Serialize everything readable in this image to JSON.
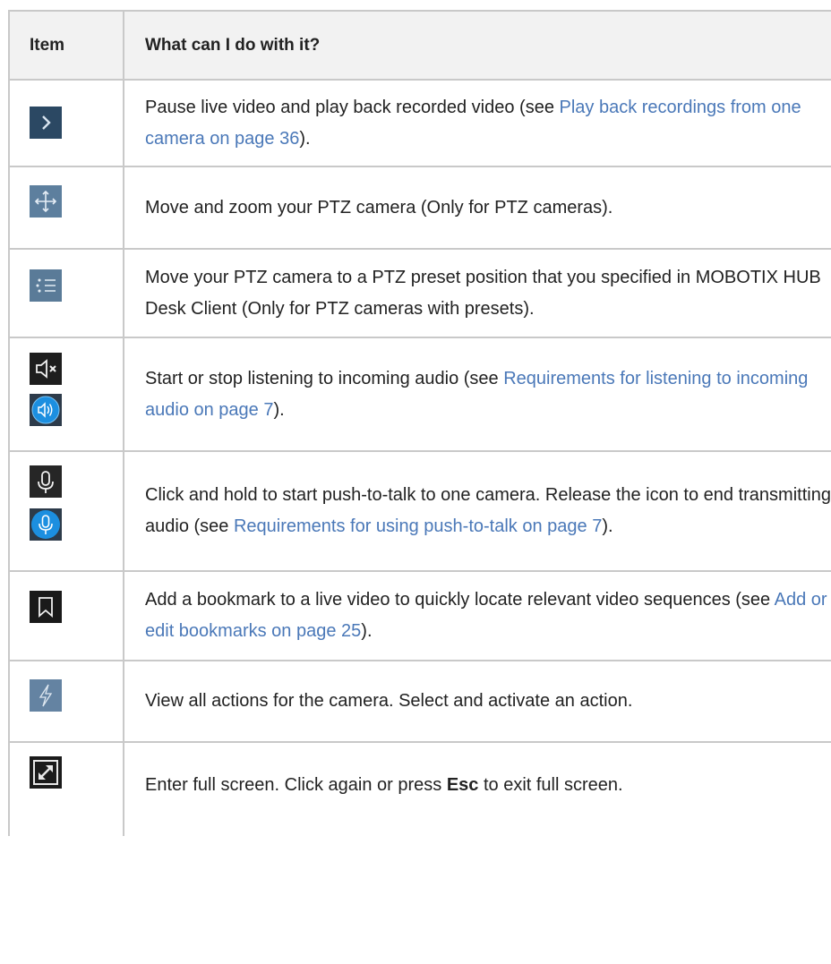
{
  "header": {
    "item": "Item",
    "description": "What can I do with it?"
  },
  "rows": [
    {
      "icon": "play-chevron-icon",
      "text_before": "Pause live video and play back recorded video (see ",
      "link": "Play back recordings from one camera on page 36",
      "text_after": ")."
    },
    {
      "icon": "ptz-move-icon",
      "text": "Move and zoom your PTZ camera (Only for PTZ cameras)."
    },
    {
      "icon": "ptz-preset-list-icon",
      "text": "Move your PTZ camera to a PTZ preset position that you specified in MOBOTIX HUB Desk Client (Only for PTZ cameras with presets)."
    },
    {
      "icon": "speaker-mute-icon",
      "icon2": "speaker-on-icon",
      "text_before": "Start or stop listening to incoming audio (see ",
      "link": "Requirements for listening to incoming audio on page 7",
      "text_after": ")."
    },
    {
      "icon": "microphone-icon",
      "icon2": "microphone-active-icon",
      "text_before": "Click and hold to start push-to-talk to one camera. Release the icon to end transmitting audio (see ",
      "link": "Requirements for using push-to-talk on page 7",
      "text_after": ")."
    },
    {
      "icon": "bookmark-icon",
      "text_before": "Add a bookmark to a live video to quickly locate relevant video sequences (see ",
      "link": "Add or edit bookmarks on page 25",
      "text_after": ")."
    },
    {
      "icon": "lightning-action-icon",
      "text": "View all actions for the camera. Select and activate an action."
    },
    {
      "icon": "fullscreen-icon",
      "text_before": "Enter full screen. Click again or press ",
      "bold": "Esc",
      "text_after": " to exit full screen."
    }
  ],
  "colors": {
    "link": "#4a78b8",
    "border": "#c9c9c9",
    "header_bg": "#f2f2f2",
    "icon_dark": "#2b3e55",
    "icon_blue": "#1c8fe0"
  }
}
